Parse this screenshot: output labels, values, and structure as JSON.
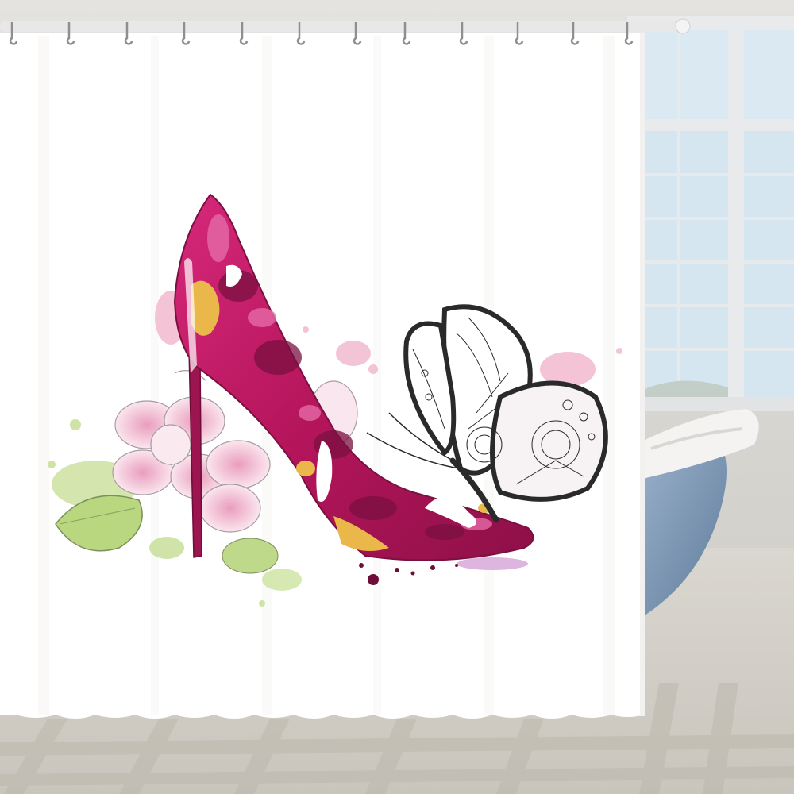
{
  "scene": {
    "subject": "shower-curtain-product-photo",
    "colors": {
      "curtain": "#ffffff",
      "curtain_shadow": "#ecebe9",
      "rod": "#e6e6e6",
      "ring": "#9a9a9a",
      "wall": "#dedcd8",
      "window_frame": "#e4e6e8",
      "sky": "#dbe9f3",
      "floor": "#eeece7",
      "tub": "#7f9ab8",
      "tub_rim": "#f3f2f0",
      "shoe_main": "#c2185b",
      "shoe_dark": "#7a1040",
      "shoe_light": "#e05a9c",
      "shoe_yellow": "#eab84a",
      "flower_pink": "#f3c7d9",
      "leaf_green": "#b9d77f",
      "butterfly_line": "#2a2a2a",
      "pink_splash": "#f2b9cf"
    },
    "icons": [
      "shower-ring-icon",
      "high-heel-shoe-icon",
      "butterfly-icon",
      "flower-icon",
      "leaf-icon"
    ]
  }
}
